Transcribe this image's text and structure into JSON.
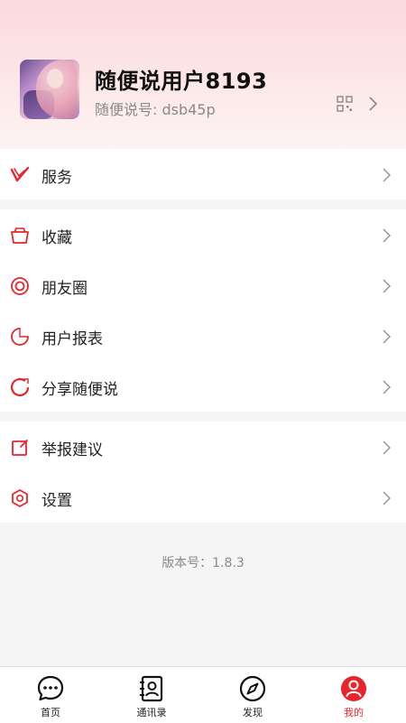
{
  "profile": {
    "name": "随便说用户8193",
    "id_text": "随便说号: dsb45p"
  },
  "menu": {
    "group1": [
      {
        "label": "服务",
        "icon": "service-icon"
      }
    ],
    "group2": [
      {
        "label": "收藏",
        "icon": "favorites-icon"
      },
      {
        "label": "朋友圈",
        "icon": "moments-icon"
      },
      {
        "label": "用户报表",
        "icon": "report-icon"
      },
      {
        "label": "分享随便说",
        "icon": "share-icon"
      }
    ],
    "group3": [
      {
        "label": "举报建议",
        "icon": "feedback-icon"
      },
      {
        "label": "设置",
        "icon": "settings-icon"
      }
    ]
  },
  "version_text": "版本号：1.8.3",
  "tabs": [
    {
      "label": "首页",
      "icon": "chat-icon"
    },
    {
      "label": "通讯录",
      "icon": "contacts-icon"
    },
    {
      "label": "发现",
      "icon": "compass-icon"
    },
    {
      "label": "我的",
      "icon": "user-icon",
      "active": true
    }
  ],
  "colors": {
    "accent": "#e6252c",
    "header_tint": "#fbd9dc",
    "background": "#f5f5f5"
  }
}
